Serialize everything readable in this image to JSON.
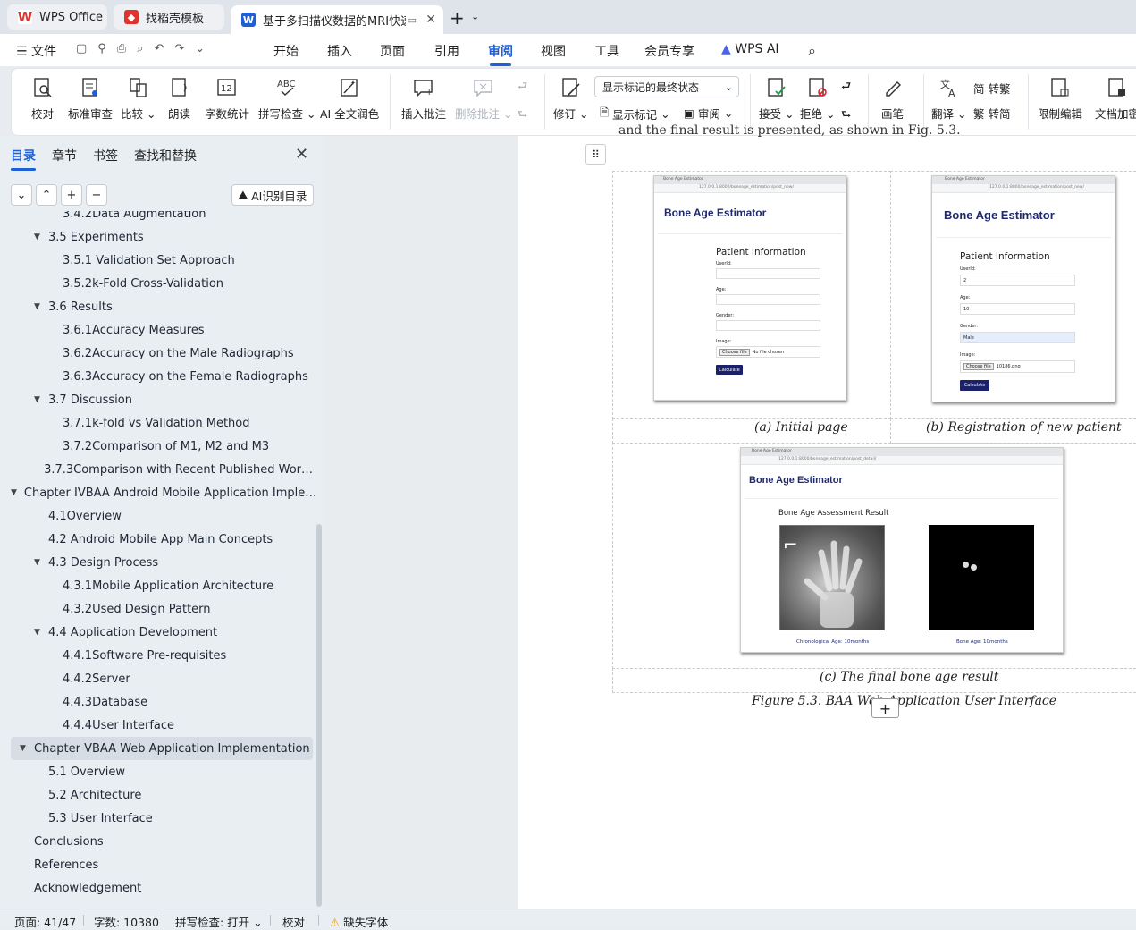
{
  "tabs": [
    {
      "label": "WPS Office"
    },
    {
      "label": "找稻壳模板"
    },
    {
      "label": "基于多扫描仪数据的MRI快速"
    }
  ],
  "menu": {
    "file": "文件",
    "items": [
      "开始",
      "插入",
      "页面",
      "引用",
      "审阅",
      "视图",
      "工具",
      "会员专享",
      "WPS AI"
    ]
  },
  "ribbon": {
    "proof": "校对",
    "std": "标准审查",
    "compare": "比较",
    "read": "朗读",
    "count": "字数统计",
    "spell": "拼写检查",
    "ai_polish": "AI 全文润色",
    "insert_comment": "插入批注",
    "delete_comment": "删除批注",
    "revise": "修订",
    "markup_select": "显示标记的最终状态",
    "show_markup": "显示标记",
    "review": "审阅",
    "accept": "接受",
    "reject": "拒绝",
    "pen": "画笔",
    "translate": "翻译",
    "t2s": "转繁",
    "s2t": "转简",
    "restrict": "限制编辑",
    "encrypt": "文档加密"
  },
  "sidebar": {
    "tabs": [
      "目录",
      "章节",
      "书签",
      "查找和替换"
    ],
    "ai_btn": "AI识别目录",
    "items": [
      {
        "label": "3.4.2Data Augmentation",
        "level": 3
      },
      {
        "label": "3.5  Experiments",
        "level": 2,
        "exp": true
      },
      {
        "label": "3.5.1  Validation Set Approach",
        "level": 3
      },
      {
        "label": "3.5.2k-Fold Cross-Validation",
        "level": 3
      },
      {
        "label": "3.6  Results",
        "level": 2,
        "exp": true
      },
      {
        "label": "3.6.1Accuracy Measures",
        "level": 3
      },
      {
        "label": "3.6.2Accuracy on the Male Radiographs",
        "level": 3
      },
      {
        "label": "3.6.3Accuracy on the Female Radiographs",
        "level": 3
      },
      {
        "label": "3.7  Discussion",
        "level": 2,
        "exp": true
      },
      {
        "label": "3.7.1k-fold vs Validation Method",
        "level": 3
      },
      {
        "label": "3.7.2Comparison of M1, M2 and M3",
        "level": 3
      },
      {
        "label": "3.7.3Comparison with Recent Published Wor…",
        "level": 3
      },
      {
        "label": "Chapter IVBAA Android Mobile Application Imple…",
        "level": 1,
        "exp": true
      },
      {
        "label": "4.1Overview",
        "level": 2
      },
      {
        "label": "4.2  Android Mobile App Main Concepts",
        "level": 2
      },
      {
        "label": "4.3  Design Process",
        "level": 2,
        "exp": true
      },
      {
        "label": "4.3.1Mobile Application Architecture",
        "level": 3
      },
      {
        "label": "4.3.2Used Design Pattern",
        "level": 3
      },
      {
        "label": "4.4  Application Development",
        "level": 2,
        "exp": true
      },
      {
        "label": "4.4.1Software Pre-requisites",
        "level": 3
      },
      {
        "label": "4.4.2Server",
        "level": 3
      },
      {
        "label": "4.4.3Database",
        "level": 3
      },
      {
        "label": "4.4.4User Interface",
        "level": 3
      },
      {
        "label": "Chapter VBAA Web Application Implementation",
        "level": 1,
        "exp": true,
        "cur": true
      },
      {
        "label": "5.1  Overview",
        "level": 2
      },
      {
        "label": "5.2  Architecture",
        "level": 2
      },
      {
        "label": "5.3  User Interface",
        "level": 2
      },
      {
        "label": "Conclusions",
        "level": 1
      },
      {
        "label": "References",
        "level": 1
      },
      {
        "label": "Acknowledgement",
        "level": 1
      }
    ]
  },
  "doc": {
    "top_text": "and the final result is presented, as shown in Fig. 5.3.",
    "shot_a": {
      "tab": "Bone Age Estimator",
      "url": "127.0.0.1:8000/boneage_estimation/post_new/",
      "title": "Bone Age Estimator",
      "form_title": "Patient Information",
      "f_user": "UserId:",
      "f_age": "Age:",
      "f_gender": "Gender:",
      "f_image": "Image:",
      "choose": "Choose file",
      "nofile": "No file chosen",
      "calc": "Calculate"
    },
    "shot_b": {
      "tab": "Bone Age Estimator",
      "url": "127.0.0.1:8000/boneage_estimation/post_new/",
      "title": "Bone Age Estimator",
      "form_title": "Patient Information",
      "f_user": "UserId:",
      "v_user": "2",
      "f_age": "Age:",
      "v_age": "10",
      "f_gender": "Gender:",
      "v_gender": "Male",
      "f_image": "Image:",
      "choose": "Choose file",
      "file": "10186.png",
      "calc": "Calculate"
    },
    "shot_c": {
      "tab": "Bone Age Estimator",
      "url": "127.0.0.1:8000/boneage_estimation/post_detail/",
      "title": "Bone Age Estimator",
      "result_title": "Bone Age Assessment Result",
      "chrono": "Chronological Age: 10months",
      "bone": "Bone Age: 10months"
    },
    "cap_a": "(a)      Initial page",
    "cap_b": "(b) Registration of new patient",
    "cap_c": "(c) The final bone age result",
    "figure": "Figure 5.3. BAA Web Application User Interface"
  },
  "status": {
    "page": "页面: 41/47",
    "words": "字数: 10380",
    "spell": "拼写检查: 打开",
    "proof": "校对",
    "font": "缺失字体"
  }
}
